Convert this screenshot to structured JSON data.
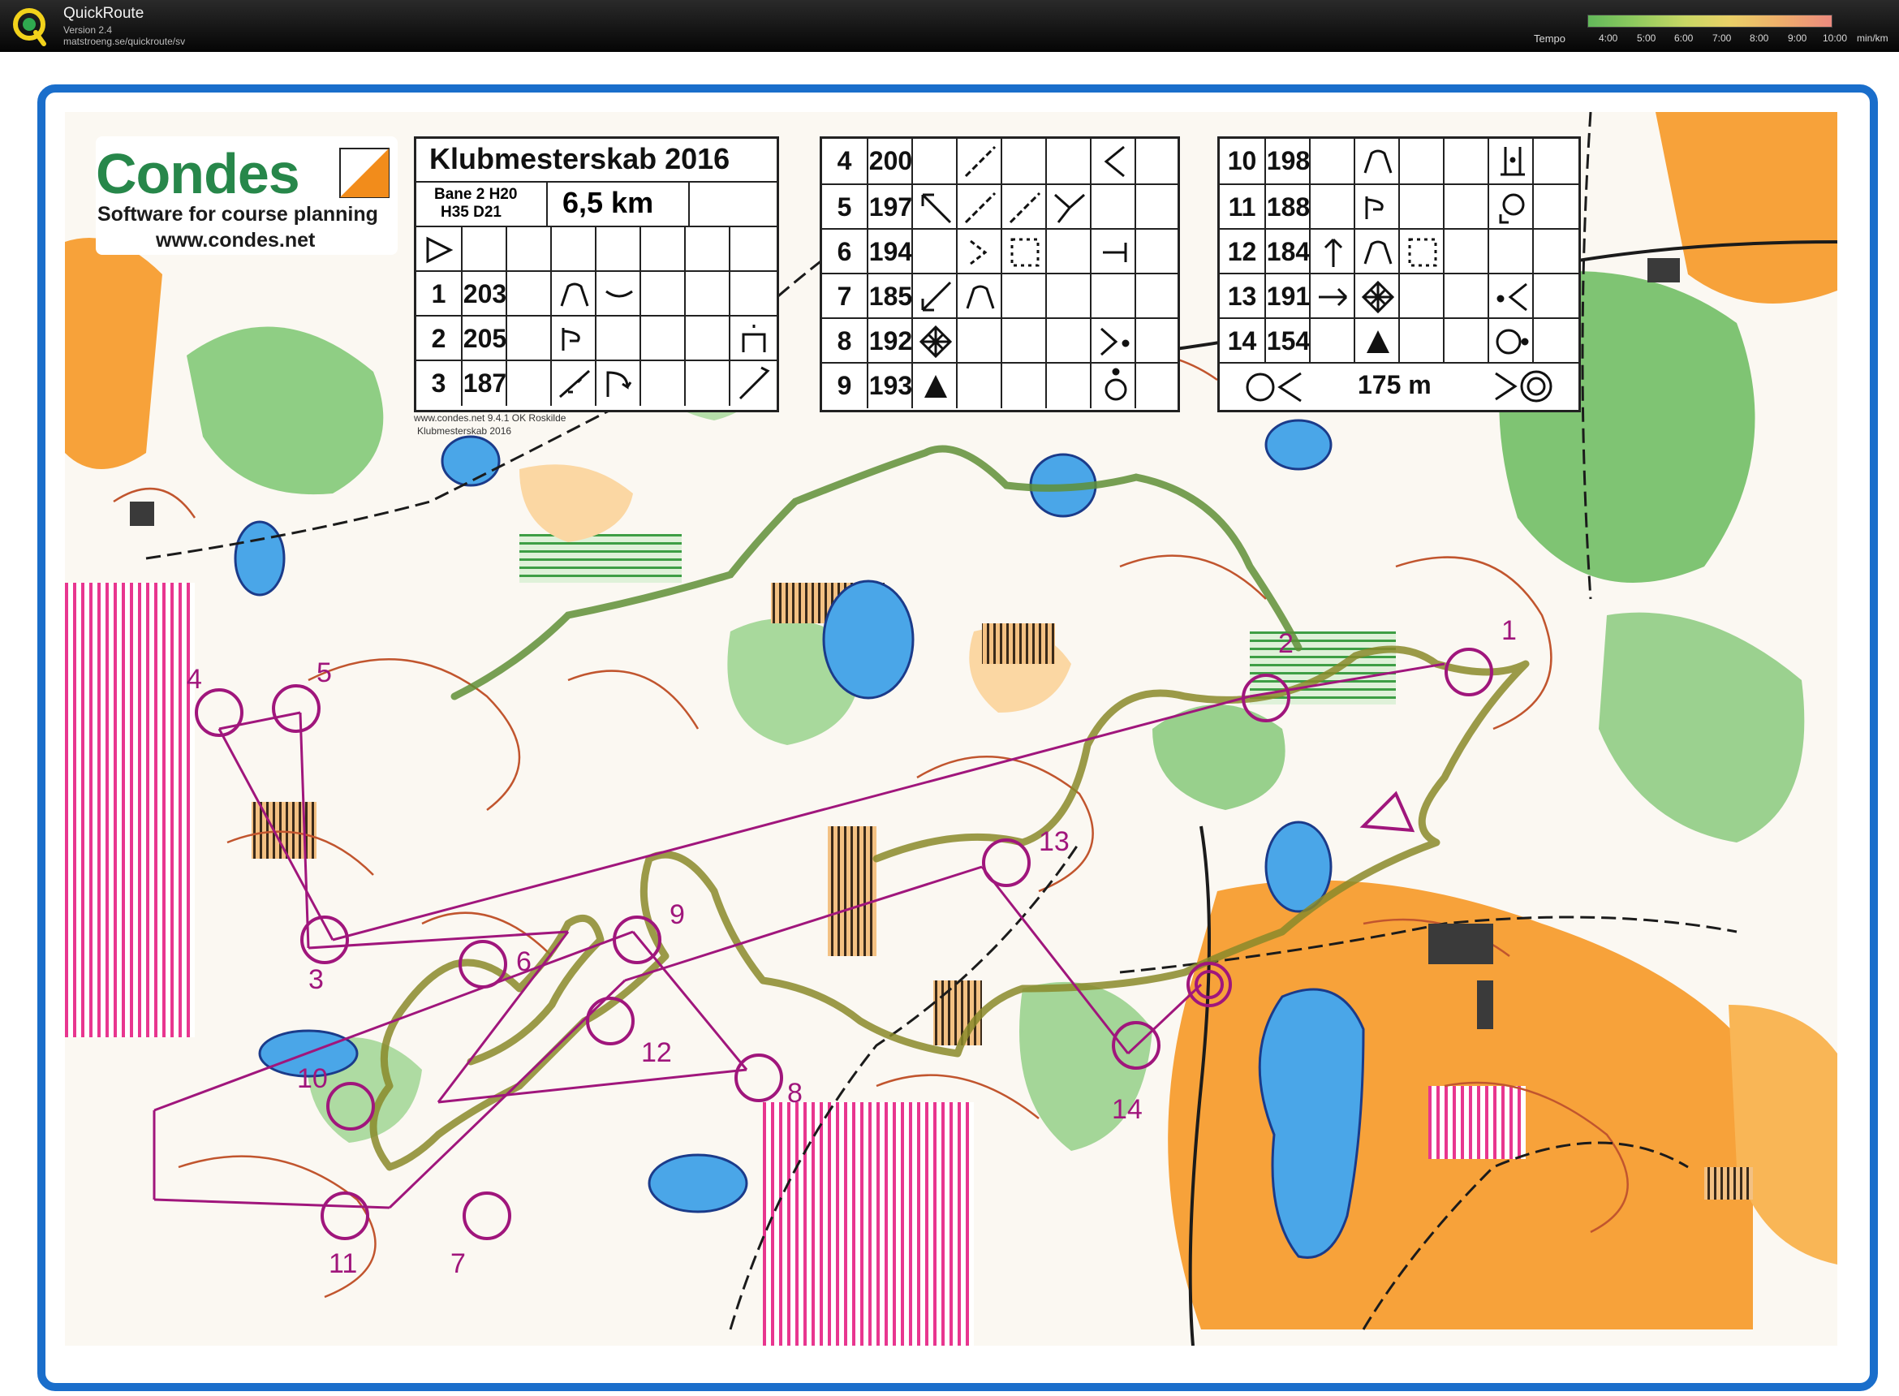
{
  "app": {
    "name": "QuickRoute",
    "version": "Version 2.4",
    "url": "matstroeng.se/quickroute/sv"
  },
  "legend": {
    "title": "Tempo",
    "ticks": [
      "4:00",
      "5:00",
      "6:00",
      "7:00",
      "8:00",
      "9:00",
      "10:00"
    ],
    "unit": "min/km"
  },
  "colors": {
    "frame": "#1a6ecb",
    "course": "#a0167c",
    "route": "#8a8a2a",
    "forest": "#3e9e45",
    "open": "#f7a23a",
    "water": "#4aa6e8",
    "contour": "#c1552e"
  },
  "condes": {
    "brand": "Condes",
    "tagline": "Software for course planning",
    "url": "www.condes.net"
  },
  "description_sheet": {
    "title": "Klubmesterskab 2016",
    "class_line1": "Bane 2 H20",
    "class_line2": "H35 D21",
    "length": "6,5 km",
    "controls": [
      {
        "n": "1",
        "code": "203"
      },
      {
        "n": "2",
        "code": "205"
      },
      {
        "n": "3",
        "code": "187"
      },
      {
        "n": "4",
        "code": "200"
      },
      {
        "n": "5",
        "code": "197"
      },
      {
        "n": "6",
        "code": "194"
      },
      {
        "n": "7",
        "code": "185"
      },
      {
        "n": "8",
        "code": "192"
      },
      {
        "n": "9",
        "code": "193"
      },
      {
        "n": "10",
        "code": "198"
      },
      {
        "n": "11",
        "code": "188"
      },
      {
        "n": "12",
        "code": "184"
      },
      {
        "n": "13",
        "code": "191"
      },
      {
        "n": "14",
        "code": "154"
      }
    ],
    "finish_distance": "175 m",
    "note1": "www.condes.net 9.4.1 OK Roskilde",
    "note2": "Klubmesterskab 2016"
  },
  "control_labels": [
    "1",
    "2",
    "3",
    "4",
    "5",
    "6",
    "7",
    "8",
    "9",
    "10",
    "11",
    "12",
    "13",
    "14"
  ]
}
